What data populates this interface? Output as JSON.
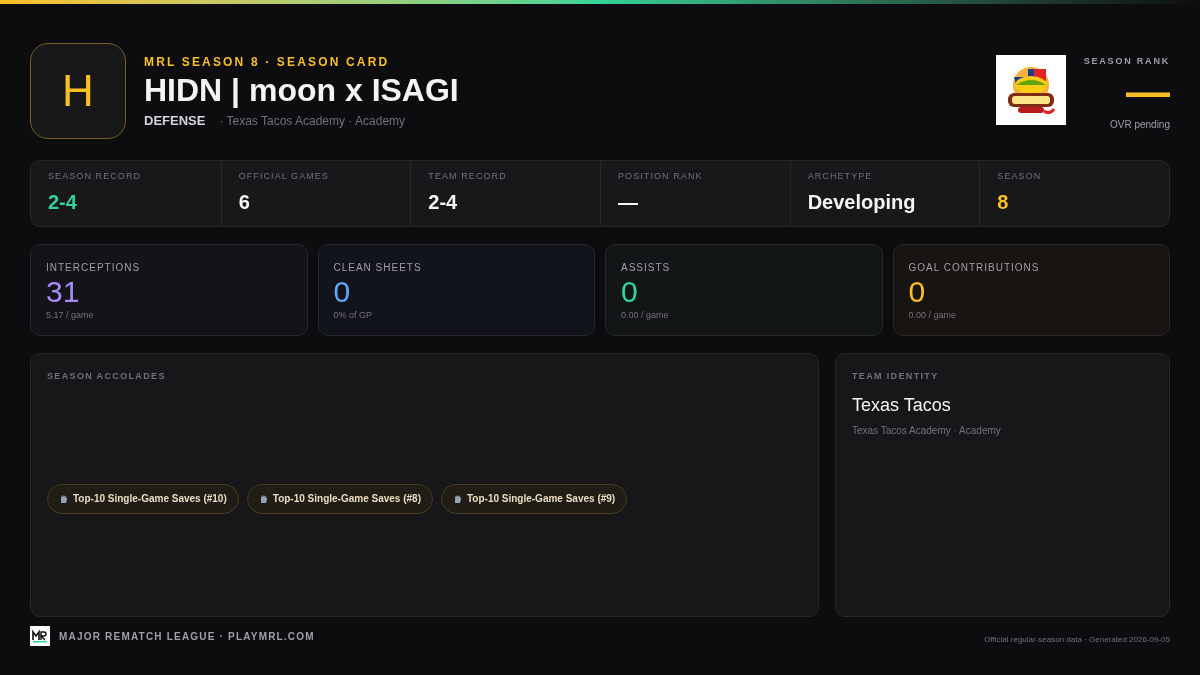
{
  "header": {
    "avatar_letter": "H",
    "eyebrow": "MRL SEASON 8 · SEASON CARD",
    "player_name": "HIDN | moon x ISAGI",
    "position": "DEFENSE",
    "team_line": "· Texas Tacos Academy · Academy",
    "rank_label": "SEASON RANK",
    "rank_value": "—",
    "rank_note": "OVR pending"
  },
  "stats": [
    {
      "label": "SEASON RECORD",
      "value": "2-4",
      "color": "#34d399"
    },
    {
      "label": "OFFICIAL GAMES",
      "value": "6",
      "color": "#f4f4f5"
    },
    {
      "label": "TEAM RECORD",
      "value": "2-4",
      "color": "#f4f4f5"
    },
    {
      "label": "POSITION RANK",
      "value": "—",
      "color": "#f4f4f5"
    },
    {
      "label": "ARCHETYPE",
      "value": "Developing",
      "color": "#f4f4f5"
    },
    {
      "label": "SEASON",
      "value": "8",
      "color": "#fbbf24"
    }
  ],
  "metrics": [
    {
      "label": "INTERCEPTIONS",
      "value": "31",
      "sub": "5.17 / game",
      "color": "#a78bfa"
    },
    {
      "label": "CLEAN SHEETS",
      "value": "0",
      "sub": "0% of GP",
      "color": "#60a5fa"
    },
    {
      "label": "ASSISTS",
      "value": "0",
      "sub": "0.00 / game",
      "color": "#34d399"
    },
    {
      "label": "GOAL CONTRIBUTIONS",
      "value": "0",
      "sub": "0.00 / game",
      "color": "#fbbf24"
    }
  ],
  "accolades": {
    "title": "SEASON ACCOLADES",
    "items": [
      "Top-10 Single-Game Saves (#10)",
      "Top-10 Single-Game Saves (#8)",
      "Top-10 Single-Game Saves (#9)"
    ]
  },
  "team_identity": {
    "title": "TEAM IDENTITY",
    "name": "Texas Tacos",
    "sub": "Texas Tacos Academy · Academy"
  },
  "footer": {
    "brand": "MAJOR REMATCH LEAGUE · PLAYMRL.COM",
    "note": "Official regular-season data · Generated 2026-09-05"
  }
}
